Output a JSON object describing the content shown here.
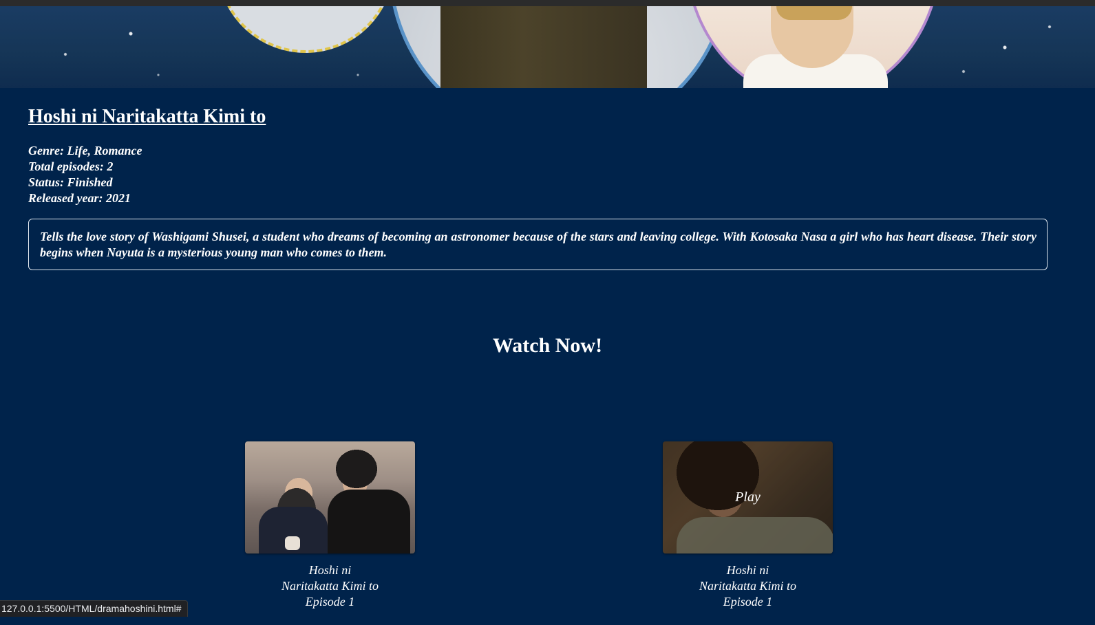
{
  "drama": {
    "title": "Hoshi ni Naritakatta Kimi to",
    "genre": "Genre: Life, Romance",
    "episodes": "Total episodes: 2",
    "status": "Status: Finished",
    "released": "Released year: 2021",
    "synopsis": "Tells the love story of Washigami Shusei, a student who dreams of becoming an astronomer because of the stars and leaving college. With Kotosaka Nasa a girl who has heart disease. Their story begins when Nayuta is a mysterious young man who comes to them."
  },
  "watch": {
    "heading": "Watch Now!",
    "episodes": [
      {
        "line1": "Hoshi ni",
        "line2": "Naritakatta Kimi to",
        "line3": "Episode 1"
      },
      {
        "line1": "Hoshi ni",
        "line2": "Naritakatta Kimi to",
        "line3": "Episode 1",
        "hover_label": "Play"
      }
    ]
  },
  "browser": {
    "status_url": "127.0.0.1:5500/HTML/dramahoshini.html#"
  },
  "colors": {
    "page_background": "#00234b",
    "text": "#ffffff"
  }
}
